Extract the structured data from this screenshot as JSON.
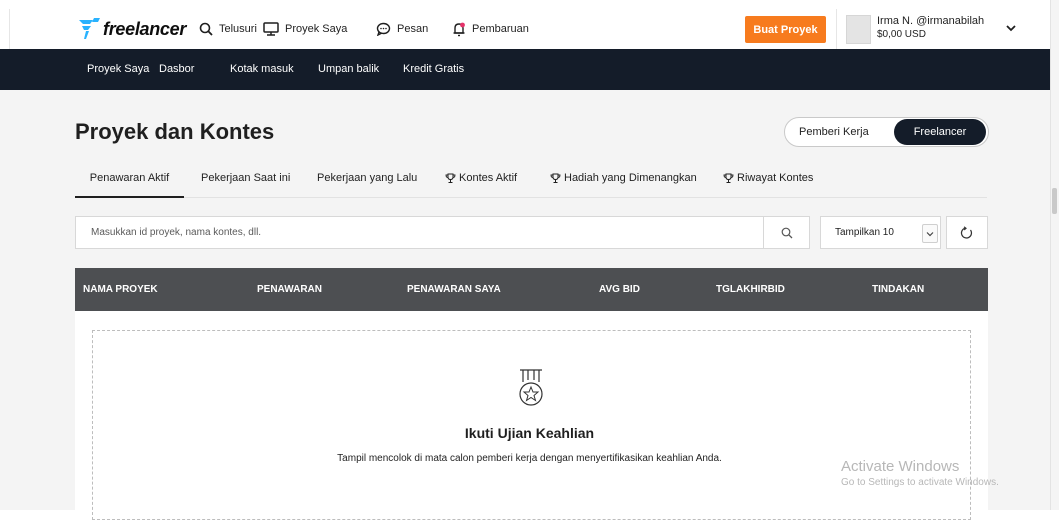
{
  "header": {
    "logo_text": "freelancer",
    "nav": [
      {
        "label": "Telusuri",
        "icon": "search-icon"
      },
      {
        "label": "Proyek Saya",
        "icon": "monitor-icon"
      },
      {
        "label": "Pesan",
        "icon": "chat-bubble-icon"
      },
      {
        "label": "Pembaruan",
        "icon": "bell-icon"
      }
    ],
    "post_project_label": "Buat Proyek",
    "user": {
      "name": "Irma N. @irmanabilah",
      "balance": "$0,00 USD"
    }
  },
  "subnav": [
    "Proyek Saya",
    "Dasbor",
    "Kotak masuk",
    "Umpan balik",
    "Kredit Gratis"
  ],
  "page": {
    "title": "Proyek dan Kontes",
    "toggle": {
      "employer": "Pemberi Kerja",
      "freelancer": "Freelancer",
      "active": "freelancer"
    },
    "tabs": [
      {
        "label": "Penawaran Aktif",
        "icon": ""
      },
      {
        "label": "Pekerjaan Saat ini",
        "icon": ""
      },
      {
        "label": "Pekerjaan yang Lalu",
        "icon": ""
      },
      {
        "label": "Kontes Aktif",
        "icon": "trophy-icon"
      },
      {
        "label": "Hadiah yang Dimenangkan",
        "icon": "trophy-icon"
      },
      {
        "label": "Riwayat Kontes",
        "icon": "trophy-icon"
      }
    ],
    "search_placeholder": "Masukkan id proyek, nama kontes, dll.",
    "show_select": "Tampilkan 10",
    "table_headers": [
      "NAMA PROYEK",
      "PENAWARAN",
      "PENAWARAN SAYA",
      "AVG BID",
      "TGLAKHIRBID",
      "TINDAKAN"
    ],
    "empty": {
      "title": "Ikuti Ujian Keahlian",
      "description": "Tampil mencolok di mata calon pemberi kerja dengan menyertifikasikan keahlian Anda."
    }
  },
  "watermark": {
    "line1": "Activate Windows",
    "line2": "Go to Settings to activate Windows."
  },
  "colors": {
    "accent": "#f77b1e",
    "nav_dark": "#141c29",
    "table_header": "#4d4f52",
    "brand_blue": "#29b2fe"
  }
}
